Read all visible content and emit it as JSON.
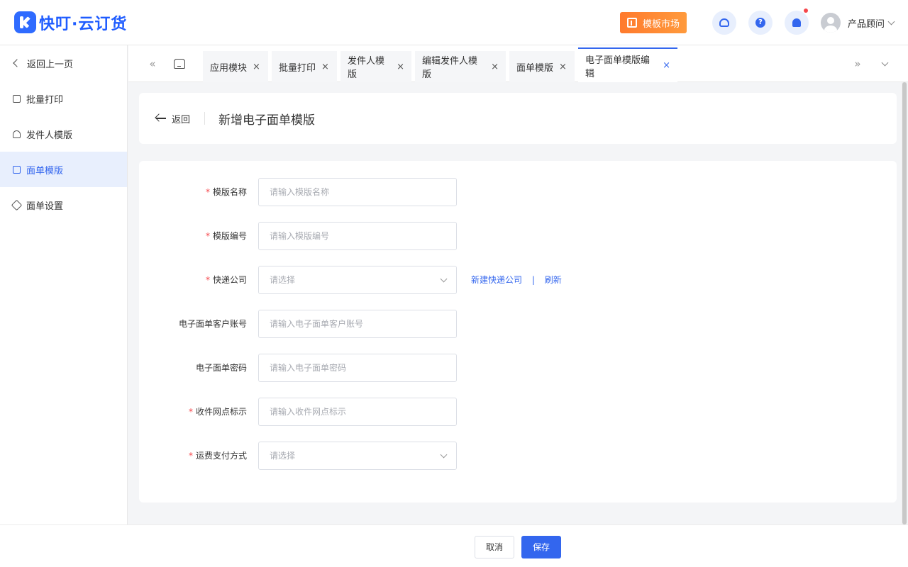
{
  "brand": {
    "name": "快叮·云订货"
  },
  "header": {
    "market_label": "模板市场",
    "user_name": "产品顾问",
    "help_glyph": "?"
  },
  "sidebar": {
    "back_label": "返回上一页",
    "items": [
      {
        "label": "批量打印",
        "icon": "printer-icon"
      },
      {
        "label": "发件人模版",
        "icon": "user-icon"
      },
      {
        "label": "面单模版",
        "icon": "document-icon",
        "active": true
      },
      {
        "label": "面单设置",
        "icon": "layers-icon"
      }
    ]
  },
  "tabs": [
    {
      "label": "应用模块",
      "close": "×"
    },
    {
      "label": "批量打印",
      "close": "×"
    },
    {
      "label": "发件人模版",
      "close": "×"
    },
    {
      "label": "编辑发件人模版",
      "close": "×"
    },
    {
      "label": "面单模版",
      "close": "×"
    },
    {
      "label": "电子面单模版编辑",
      "close": "×",
      "active": true
    }
  ],
  "tab_nav": {
    "prev": "«",
    "next": "»"
  },
  "page": {
    "back_label": "返回",
    "title": "新增电子面单模版"
  },
  "form": {
    "fields": [
      {
        "label": "模版名称",
        "required": true,
        "type": "input",
        "placeholder": "请输入模版名称"
      },
      {
        "label": "模版编号",
        "required": true,
        "type": "input",
        "placeholder": "请输入模版编号"
      },
      {
        "label": "快递公司",
        "required": true,
        "type": "select",
        "placeholder": "请选择"
      },
      {
        "label": "电子面单客户账号",
        "required": false,
        "type": "input",
        "placeholder": "请输入电子面单客户账号"
      },
      {
        "label": "电子面单密码",
        "required": false,
        "type": "input",
        "placeholder": "请输入电子面单密码"
      },
      {
        "label": "收件网点标示",
        "required": true,
        "type": "input",
        "placeholder": "请输入收件网点标示"
      },
      {
        "label": "运费支付方式",
        "required": true,
        "type": "select",
        "placeholder": "请选择"
      }
    ],
    "required_mark": "*",
    "links": {
      "new_courier": "新建快递公司",
      "separator": "|",
      "refresh": "刷新"
    }
  },
  "footer": {
    "cancel_label": "取消",
    "save_label": "保存"
  },
  "colors": {
    "primary": "#3366ee",
    "accent_orange": "#ff8a34",
    "required_red": "#f5464b"
  }
}
